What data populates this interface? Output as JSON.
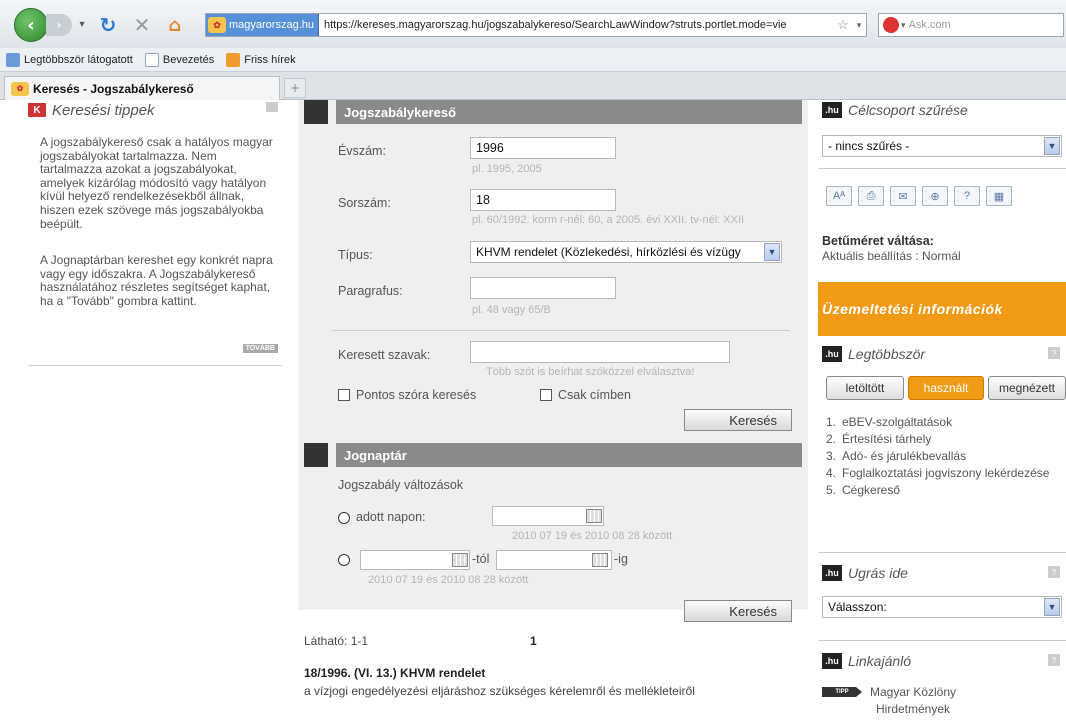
{
  "browser": {
    "site_identity": "magyarorszag.hu",
    "url": "https://kereses.magyarorszag.hu/jogszabalykereso/SearchLawWindow?struts.portlet.mode=vie",
    "search_placeholder": "Ask.com",
    "bookmarks": [
      "Legtöbbször látogatott",
      "Bevezetés",
      "Friss hírek"
    ],
    "tab_title": "Keresés - Jogszabálykereső",
    "new_tab": "+"
  },
  "left": {
    "title": "Keresési tippek",
    "paragraph1": "A jogszabálykereső csak a hatályos magyar jogszabályokat tartalmazza. Nem tartalmazza azokat a jogszabályokat, amelyek kizárólag módosító vagy hatályon kívül helyező rendelkezésekből állnak, hiszen ezek szövege más jogszabályokba beépült.",
    "paragraph2": "A Jognaptárban kereshet egy konkrét napra vagy egy időszakra. A Jogszabálykereső használatához részletes segítséget kaphat, ha a \"Tovább\" gombra kattint.",
    "more_button": "TOVÁBB"
  },
  "search": {
    "title": "Jogszabálykereső",
    "year_label": "Évszám:",
    "year_value": "1996",
    "year_hint": "pl. 1995, 2005",
    "number_label": "Sorszám:",
    "number_value": "18",
    "number_hint": "pl. 60/1992. korm r-nél: 60, a 2005. évi XXII. tv-nél: XXII",
    "type_label": "Típus:",
    "type_value": "KHVM rendelet (Közlekedési, hírközlési és vízügy",
    "paragraph_label": "Paragrafus:",
    "paragraph_value": "",
    "paragraph_hint": "pl. 48 vagy 65/B",
    "words_label": "Keresett szavak:",
    "words_value": "",
    "words_hint": "Több szót is beírhat szóközzel elválasztva!",
    "exact_checkbox": "Pontos szóra keresés",
    "title_checkbox": "Csak címben",
    "search_button": "Keresés"
  },
  "calendar": {
    "title": "Jognaptár",
    "subtitle": "Jogszabály változások",
    "on_date_label": "adott napon:",
    "range_hint": "2010 07 19 és 2010 08 28 között",
    "from_suffix": "-tól",
    "to_suffix": "-ig",
    "search_button": "Keresés"
  },
  "results": {
    "visible": "Látható: 1-1",
    "page": "1",
    "item_title": "18/1996. (VI. 13.) KHVM rendelet",
    "item_desc": "a vízjogi engedélyezési eljáráshoz szükséges kérelemről és mellékleteiről"
  },
  "right": {
    "target_title": "Célcsoport szűrése",
    "target_value": "- nincs szűrés -",
    "tools": [
      "Aᴬ",
      "⎙",
      "✉",
      "⊕",
      "?",
      "▦"
    ],
    "font_title": "Betűméret váltása:",
    "font_current": "Aktuális beállítás : Normál",
    "operation_info": "Üzemeltetési információk",
    "hu_badge": ".hu",
    "top_title": "Legtöbbször",
    "top_tabs": [
      "letöltött",
      "használt",
      "megnézett"
    ],
    "top_items": [
      {
        "num": "1.",
        "text": "eBEV-szolgáltatások"
      },
      {
        "num": "2.",
        "text": "Értesítési tárhely"
      },
      {
        "num": "3.",
        "text": "Adó- és járulékbevallás"
      },
      {
        "num": "4.",
        "text": "Foglalkoztatási jogviszony lekérdezése"
      },
      {
        "num": "5.",
        "text": "Cégkereső"
      }
    ],
    "jump_title": "Ugrás ide",
    "jump_value": "Válasszon:",
    "links_title": "Linkajánló",
    "tip_badge": "TIPP",
    "tip_text": "Magyar Közlöny Hirdetmények",
    "help_icon": "?"
  },
  "colors": {
    "accent": "#f09a16",
    "header_bar": "#8a8a8a",
    "panel_bg": "#efefef"
  }
}
